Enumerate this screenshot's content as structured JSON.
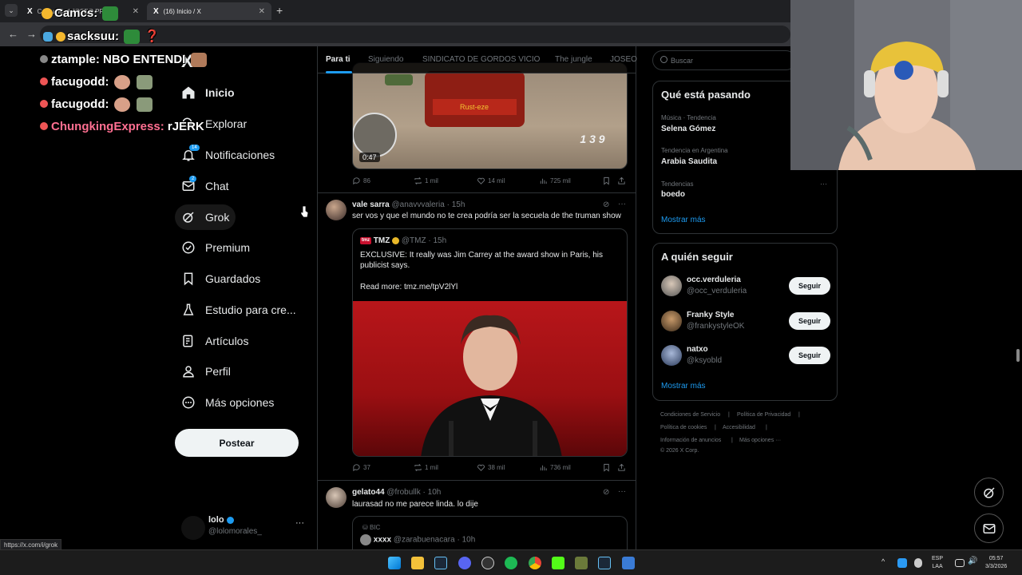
{
  "browser": {
    "tabs": [
      {
        "label": "Comunidad JOSEO PRIME"
      },
      {
        "label": "(16) Inicio / X"
      }
    ],
    "new_tab": "+",
    "status_url": "https://x.com/i/grok"
  },
  "stream_overlay": {
    "chat": [
      {
        "user": "Camcs:",
        "message": ""
      },
      {
        "user": "sacksuu:",
        "message": ""
      },
      {
        "user": "ztample:",
        "message": "NBO ENTENDI"
      },
      {
        "user": "facugodd:",
        "message": ""
      },
      {
        "user": "facugodd:",
        "message": ""
      },
      {
        "user": "ChungkingExpress:",
        "message": "rJERK"
      }
    ]
  },
  "nav": {
    "logo": "X",
    "items": [
      {
        "label": "Inicio",
        "icon": "home-icon"
      },
      {
        "label": "Explorar",
        "icon": "search-icon"
      },
      {
        "label": "Notificaciones",
        "icon": "bell-icon",
        "badge": "14"
      },
      {
        "label": "Chat",
        "icon": "mail-icon",
        "badge": "2"
      },
      {
        "label": "Grok",
        "icon": "grok-icon"
      },
      {
        "label": "Premium",
        "icon": "premium-icon"
      },
      {
        "label": "Guardados",
        "icon": "bookmark-icon"
      },
      {
        "label": "Estudio para cre...",
        "icon": "studio-icon"
      },
      {
        "label": "Artículos",
        "icon": "article-icon"
      },
      {
        "label": "Perfil",
        "icon": "person-icon"
      },
      {
        "label": "Más opciones",
        "icon": "more-circle-icon"
      }
    ],
    "post_button": "Postear",
    "account": {
      "name": "lolo",
      "handle": "@lolomorales_",
      "more": "···"
    }
  },
  "timeline": {
    "tabs": [
      "Para ti",
      "Siguiendo",
      "SINDICATO DE GORDOS VICIO",
      "The jungle",
      "JOSEO"
    ],
    "first_post": {
      "video_time": "0:47",
      "speed_text": "1 3 9",
      "car_text": "Rust-eze",
      "stats": {
        "replies": "86",
        "reposts": "1 mil",
        "likes": "14 mil",
        "views": "725 mil"
      }
    },
    "second_post": {
      "name": "vale sarra",
      "handle": "@anavvvaleria",
      "time": "15h",
      "text": "ser vos y que el mundo no te crea podría ser la secuela de the truman show",
      "quote": {
        "name": "TMZ",
        "handle": "@TMZ",
        "time": "15h",
        "text1": "EXCLUSIVE: It really was Jim Carrey at the award show in Paris, his",
        "text2": "publicist says.",
        "text3": "Read more: tmz.me/tpV2lYl",
        "logo": "tmz"
      },
      "stats": {
        "replies": "37",
        "reposts": "1 mil",
        "likes": "38 mil",
        "views": "736 mil"
      }
    },
    "third_post": {
      "name": "gelato44",
      "handle": "@frobullk",
      "time": "10h",
      "text": "laurasad no me parece linda. lo dije",
      "quote": {
        "context": "BIC",
        "name": "xxxx",
        "handle": "@zarabuenacara",
        "time": "10h"
      }
    }
  },
  "sidebar": {
    "search_placeholder": "Buscar",
    "trends_title": "Qué está pasando",
    "trends": [
      {
        "category": "Música · Tendencia",
        "name": "Selena Gómez"
      },
      {
        "category": "Tendencia en Argentina",
        "name": "Arabia Saudita"
      },
      {
        "category": "Tendencias",
        "name": "boedo"
      }
    ],
    "trend_more": "···",
    "trends_more": "Mostrar más",
    "follow_title": "A quién seguir",
    "follow": [
      {
        "name": "occ.verduleria",
        "handle": "@occ_verduleria",
        "button": "Seguir"
      },
      {
        "name": "Franky Style",
        "handle": "@frankystyleOK",
        "button": "Seguir"
      },
      {
        "name": "natxo",
        "handle": "@ksyobld",
        "button": "Seguir"
      }
    ],
    "follow_more": "Mostrar más",
    "footer": [
      "Condiciones de Servicio",
      "Política de Privacidad",
      "Política de cookies",
      "Accesibilidad",
      "Información de anuncios",
      "Más opciones ···",
      "© 2026 X Corp."
    ],
    "footer_sep": "|"
  },
  "taskbar": {
    "lang1": "ESP",
    "lang2": "LAA",
    "time": "05:57",
    "date": "3/3/2026"
  }
}
